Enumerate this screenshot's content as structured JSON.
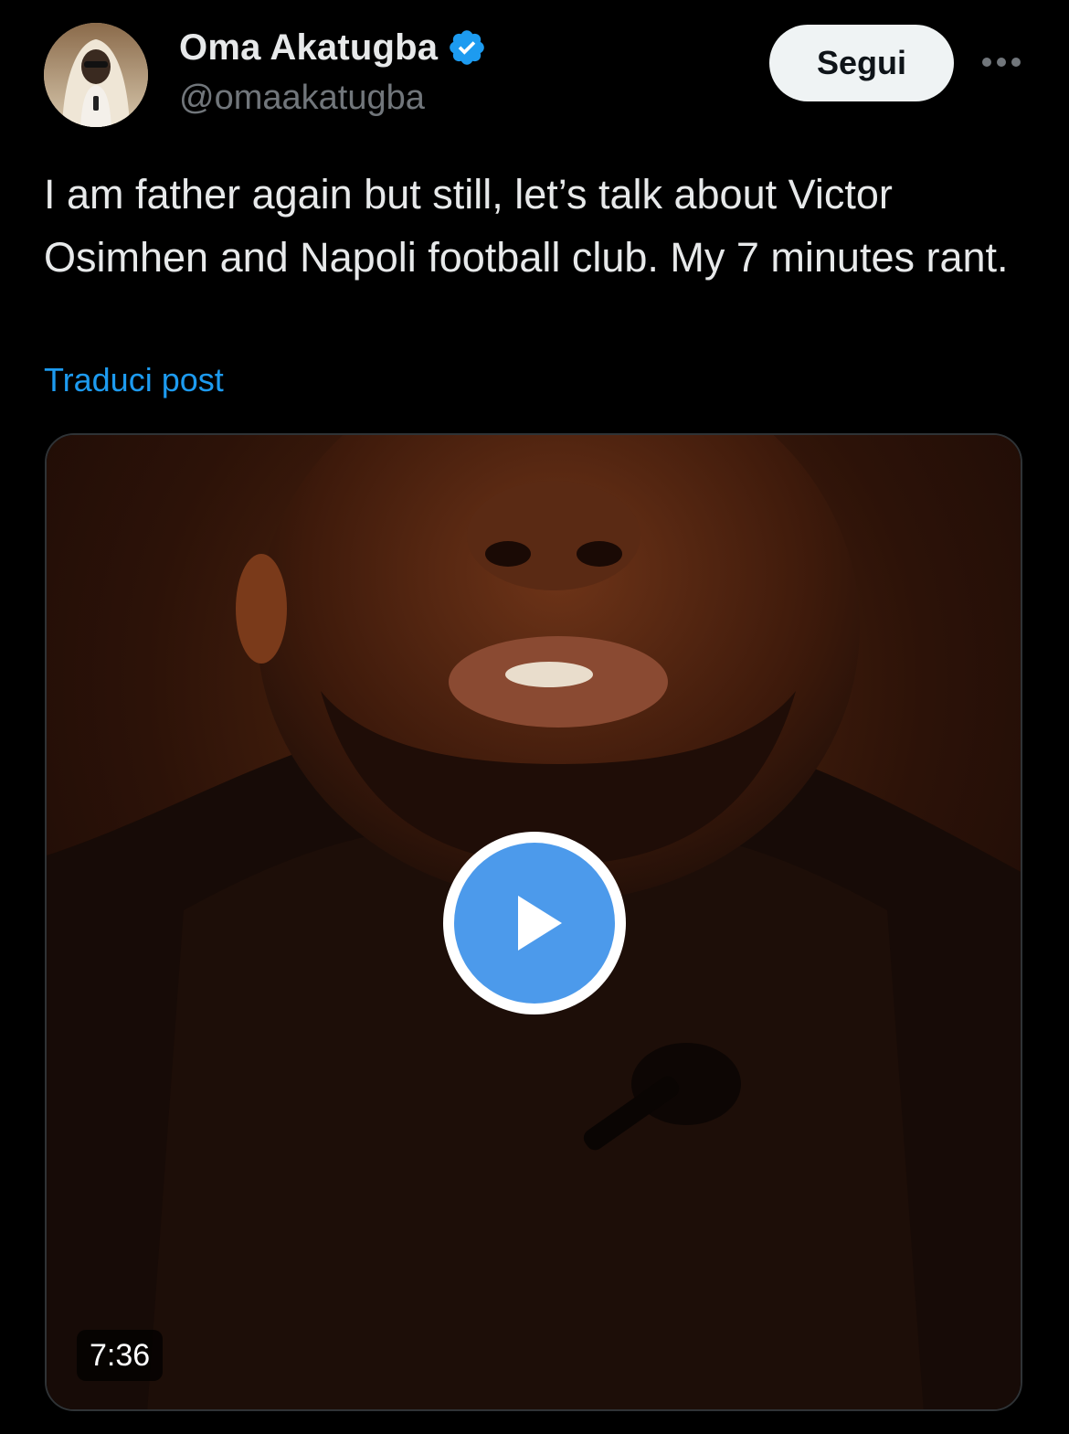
{
  "author": {
    "display_name": "Oma Akatugba",
    "handle": "@omaakatugba",
    "verified": true
  },
  "actions": {
    "follow_label": "Segui"
  },
  "post": {
    "text": "I am father again but still, let’s talk about Victor Osimhen and Napoli football club. My 7 minutes rant.",
    "translate_label": "Traduci post"
  },
  "video": {
    "duration": "7:36"
  },
  "colors": {
    "background": "#000000",
    "text_primary": "#e7e9ea",
    "text_secondary": "#71767b",
    "link": "#1d9bf0",
    "play_button": "#4c9aeb",
    "follow_button_bg": "#eff3f4"
  },
  "icons": {
    "verified": "verified-badge-icon",
    "more": "more-options-icon",
    "play": "play-icon"
  }
}
